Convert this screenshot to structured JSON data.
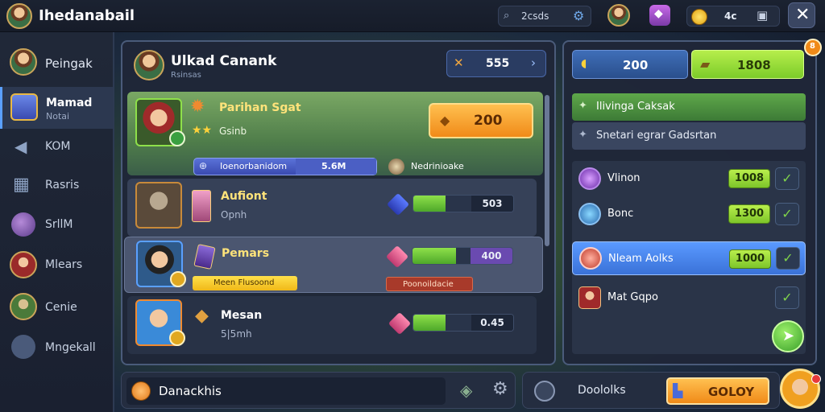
{
  "app": {
    "title": "Ihedanabail"
  },
  "topbar": {
    "search_value": "2csds",
    "coin_value": "4c"
  },
  "sidebar": {
    "items": [
      {
        "label": "Peingak",
        "sub": ""
      },
      {
        "label": "Mamad",
        "sub": "Notai"
      },
      {
        "label": "KOM",
        "sub": ""
      },
      {
        "label": "Rasris",
        "sub": ""
      },
      {
        "label": "SrllM",
        "sub": ""
      },
      {
        "label": "Mlears",
        "sub": ""
      },
      {
        "label": "Cenie",
        "sub": ""
      },
      {
        "label": "Mngekall",
        "sub": ""
      }
    ]
  },
  "main": {
    "title": "Ulkad Canank",
    "subtitle": "Rsinsas",
    "top_counter": "555",
    "rows": [
      {
        "name": "Parihan Sgat",
        "sub": "Gsinb",
        "button": "200",
        "bar_label": "Ioenorbanidom",
        "bar_value": "5.6M",
        "side_label": "Nedrinioake"
      },
      {
        "name": "Aufiont",
        "sub": "Opnh",
        "progress": 0.55,
        "bar_value": "503"
      },
      {
        "name": "Pemars",
        "sub": "",
        "progress": 0.75,
        "bar_value": "400",
        "tag": "Meen Flusoond",
        "side_label": "Poonoildacie"
      },
      {
        "name": "Mesan",
        "sub": "5|5mh",
        "progress": 0.55,
        "bar_value": "0.45"
      }
    ]
  },
  "right": {
    "currency_a": "200",
    "currency_b": "1808",
    "options": [
      {
        "label": "Ilivinga Caksak"
      },
      {
        "label": "Snetari egrar Gadsrtan"
      }
    ],
    "rewards": [
      {
        "label": "Vlinon",
        "value": "1008"
      },
      {
        "label": "Bonc",
        "value": "1300"
      },
      {
        "label": "Nleam Aolks",
        "value": "1000"
      },
      {
        "label": "Mat Gqpo",
        "value": ""
      }
    ],
    "notif_count": "8"
  },
  "bottom": {
    "left_label": "Danackhis",
    "mid_label": "Doololks",
    "action_button": "GOLOY"
  },
  "colors": {
    "accent_orange": "#f5a123",
    "accent_green": "#7ed03a",
    "accent_blue": "#3f7ed8"
  }
}
